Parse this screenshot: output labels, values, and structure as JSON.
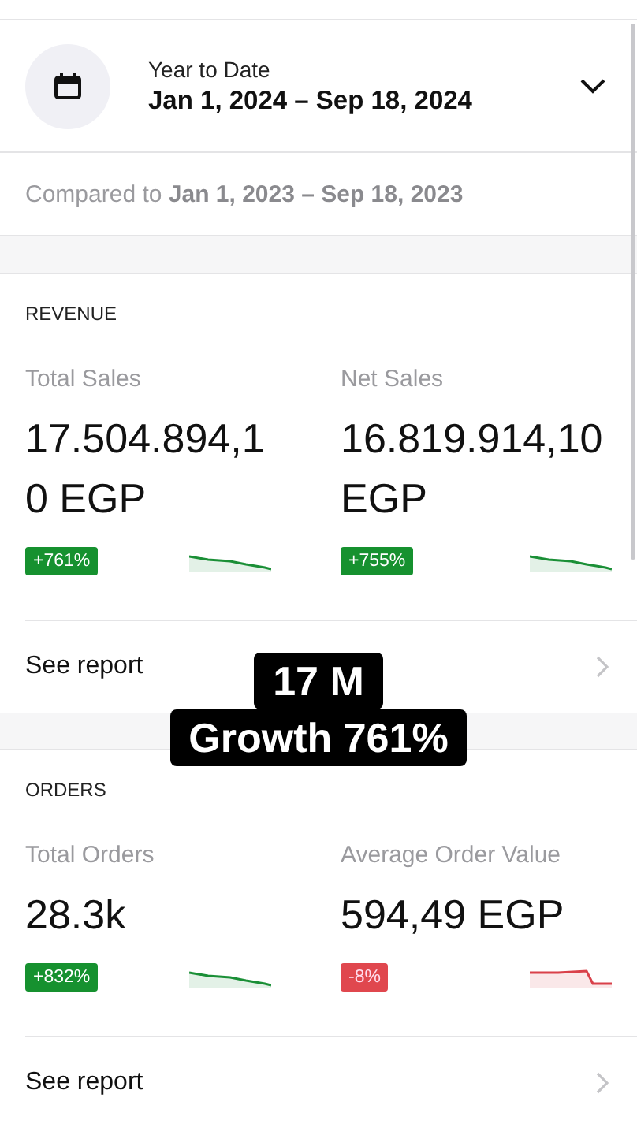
{
  "date_range": {
    "label": "Year to Date",
    "range": "Jan 1, 2024 – Sep 18, 2024",
    "expanded": false
  },
  "comparison": "Compared to **Jan 1, 2023 – Sep 18, 2023**",
  "sections": [
    {
      "title": "REVENUE",
      "metrics": [
        {
          "label": "Total Sales",
          "value": "17.504.894,10 EGP",
          "change": "+761%",
          "kind": "up"
        },
        {
          "label": "Net Sales",
          "value": "16.819.914,10 EGP",
          "change": "+755%",
          "kind": "up"
        }
      ],
      "link": "See report"
    },
    {
      "title": "ORDERS",
      "metrics": [
        {
          "label": "Total Orders",
          "value": "28.3k",
          "change": "+832%",
          "kind": "up"
        },
        {
          "label": "Average Order Value",
          "value": "594,49 EGP",
          "change": "-8%",
          "kind": "down"
        }
      ],
      "link": "See report"
    }
  ],
  "overlay_caption": [
    "17 M",
    "Growth 761%"
  ]
}
